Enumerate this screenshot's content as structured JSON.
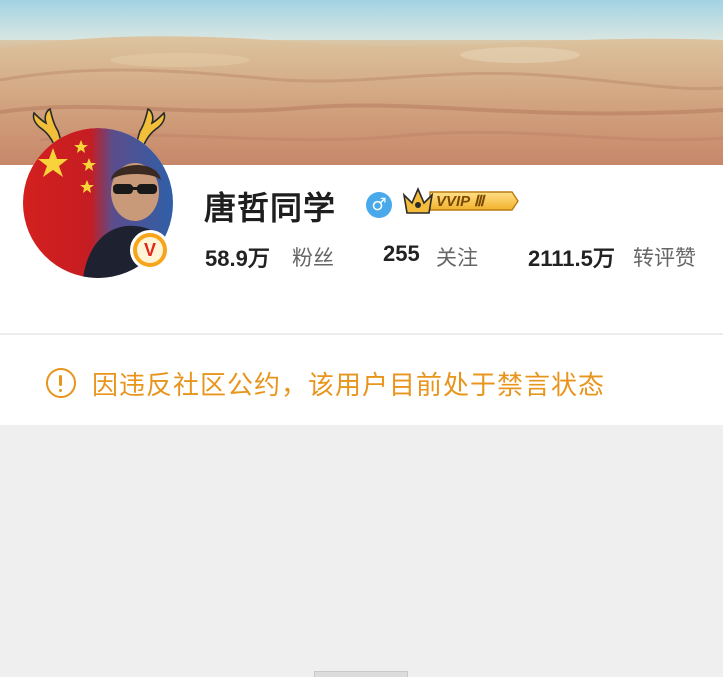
{
  "profile": {
    "username": "唐哲同学",
    "gender_symbol": "♂",
    "vip_badge": "VVIP Ⅲ",
    "verified_badge": "V",
    "stats": [
      {
        "value": "58.9万",
        "label": "粉丝"
      },
      {
        "value": "255",
        "label": "关注"
      },
      {
        "value": "2111.5万",
        "label": "转评赞"
      }
    ]
  },
  "notice": {
    "icon": "alert-circle-icon",
    "text": "因违反社区公约，该用户目前处于禁言状态"
  },
  "colors": {
    "notice": "#e8951d",
    "gender": "#4aa9ea",
    "verified": "#f7a51a",
    "vip_gold": "#f6c342"
  }
}
